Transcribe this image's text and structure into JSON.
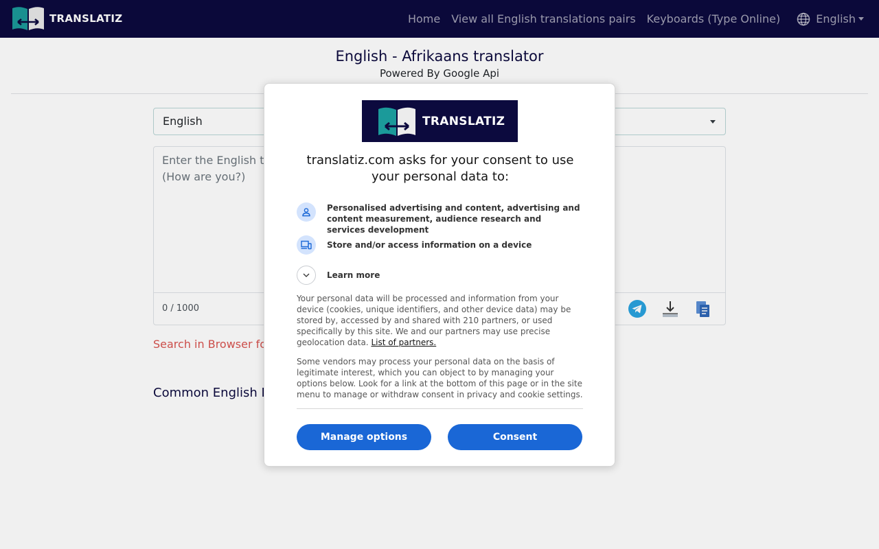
{
  "navbar": {
    "brand": "TRANSLATIZ",
    "links": [
      "Home",
      "View all English translations pairs",
      "Keyboards (Type Online)"
    ],
    "language": "English",
    "colors": {
      "background": "#0c0a3e",
      "accent": "#1b9a9a"
    }
  },
  "page": {
    "title": "English - Afrikaans translator",
    "subtitle": "Powered By Google Api",
    "source_language": "English",
    "target_language": "",
    "input_placeholder": "Enter the English text\n(How are you?)",
    "counter": "0 / 1000",
    "search_link": "Search in Browser fo",
    "common_title": "Common English Ph"
  },
  "consent": {
    "logo_text": "TRANSLATIZ",
    "heading": "translatiz.com asks for your consent to use your personal data to:",
    "purposes": [
      {
        "icon": "person-icon",
        "text": "Personalised advertising and content, advertising and content measurement, audience research and services development"
      },
      {
        "icon": "devices-icon",
        "text": "Store and/or access information on a device"
      }
    ],
    "learn_more": "Learn more",
    "paragraph1": "Your personal data will be processed and information from your device (cookies, unique identifiers, and other device data) may be stored by, accessed by and shared with 210 partners, or used specifically by this site. We and our partners may use precise geolocation data.",
    "partners_link": "List of partners.",
    "paragraph2": "Some vendors may process your personal data on the basis of legitimate interest, which you can object to by managing your options below. Look for a link at the bottom of this page or in the site menu to manage or withdraw consent in privacy and cookie settings.",
    "manage_button": "Manage options",
    "consent_button": "Consent",
    "button_color": "#1a67d6"
  }
}
